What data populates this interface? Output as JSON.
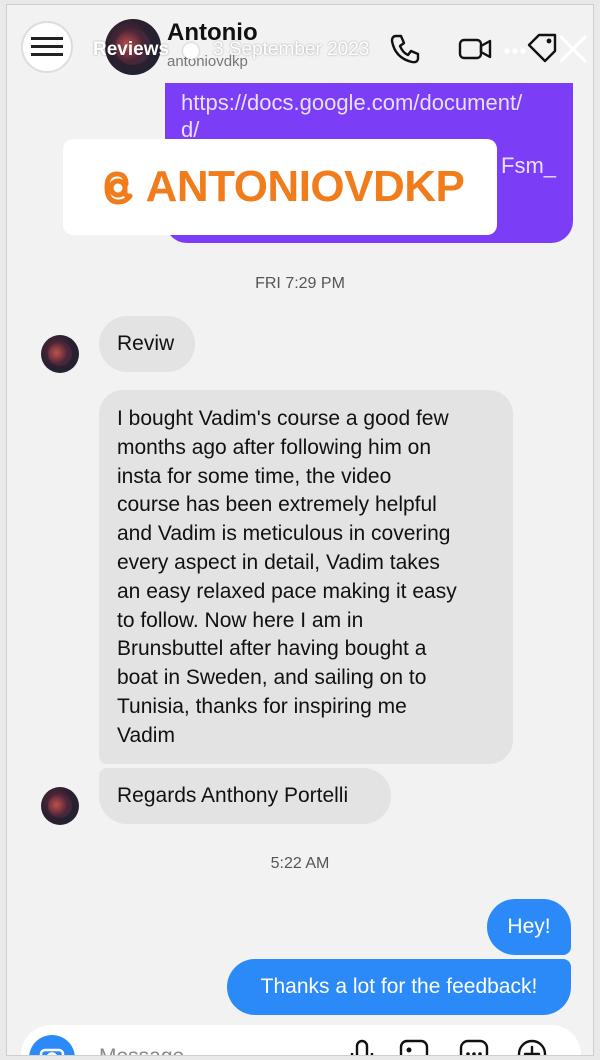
{
  "header": {
    "contact_name": "Antonio",
    "contact_username": "antoniovdkp",
    "story_label": "Reviews",
    "story_date": "3 September 2023",
    "icons": [
      "phone-icon",
      "video-icon",
      "more-icon",
      "tag-icon",
      "close-icon"
    ]
  },
  "shared_link": {
    "line1": "https://docs.google.com/document/",
    "line2": "d/",
    "tail": "Fsm_"
  },
  "sticker": {
    "text": "ANTONIOVDKP",
    "color": "#f07c1c"
  },
  "timestamps": {
    "first": "FRI 7:29 PM",
    "second": "5:22 AM"
  },
  "messages": {
    "in1": "Reviw",
    "in2_lines": [
      "I bought Vadim's course a good few",
      "months ago after following him on",
      "insta for some time, the video",
      "course has been extremely helpful",
      "and Vadim is meticulous in covering",
      "every aspect in detail, Vadim takes",
      "an easy relaxed pace making it easy",
      "to follow. Now here I am in",
      "Brunsbuttel after having bought a",
      "boat in Sweden, and sailing on to",
      "Tunisia, thanks for inspiring me",
      "Vadim"
    ],
    "in3": "Regards Anthony Portelli",
    "out1": "Hey!",
    "out2": "Thanks a lot for the feedback!"
  },
  "composer": {
    "placeholder": "Message"
  },
  "colors": {
    "accent": "#2b8af7",
    "link_bubble": "#7b3df5",
    "incoming_bubble": "#e3e3e3"
  }
}
